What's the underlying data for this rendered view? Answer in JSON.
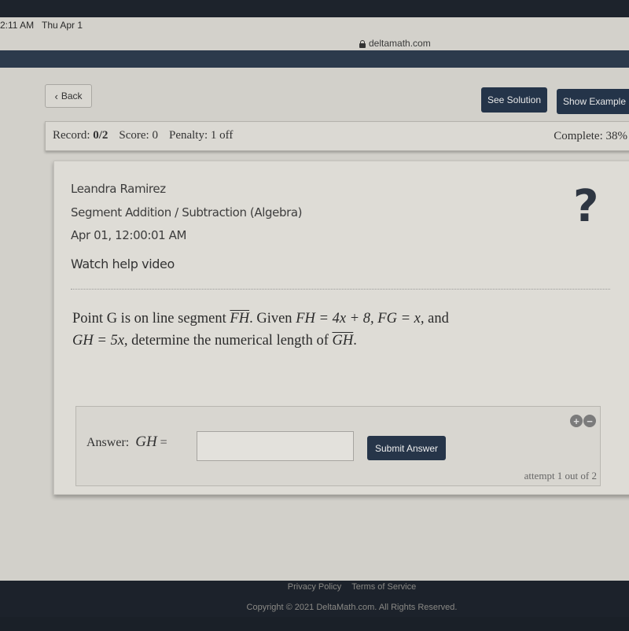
{
  "status_bar": {
    "time": "2:11 AM",
    "date": "Thu Apr 1"
  },
  "browser": {
    "url": "deltamath.com",
    "lock_icon": "lock-icon"
  },
  "toolbar": {
    "back_label": "Back",
    "see_solution_label": "See Solution",
    "show_example_label": "Show Example"
  },
  "record_bar": {
    "record_label": "Record:",
    "record_value": "0/2",
    "score_label": "Score:",
    "score_value": "0",
    "penalty_label": "Penalty:",
    "penalty_value": "1 off",
    "complete_label": "Complete:",
    "complete_value": "38%"
  },
  "assignment": {
    "student_name": "Leandra Ramirez",
    "topic": "Segment Addition / Subtraction (Algebra)",
    "date": "Apr 01, 12:00:01 AM",
    "help_video_label": "Watch help video",
    "help_icon": "?"
  },
  "problem": {
    "p1": "Point G is on line segment ",
    "seg1": "FH",
    "p2": ". Given ",
    "eq1": "FH = 4x + 8, FG = x,",
    "p3": " and",
    "eq2": "GH = 5x,",
    "p4": " determine the numerical length of ",
    "seg2": "GH",
    "p5": "."
  },
  "answer": {
    "label": "Answer:",
    "variable": "GH",
    "equals": "=",
    "input_value": "",
    "submit_label": "Submit Answer",
    "plus": "+",
    "minus": "−",
    "attempt_text": "attempt 1 out of 2"
  },
  "footer": {
    "privacy": "Privacy Policy",
    "terms": "Terms of Service",
    "copyright": "Copyright © 2021 DeltaMath.com. All Rights Reserved."
  }
}
